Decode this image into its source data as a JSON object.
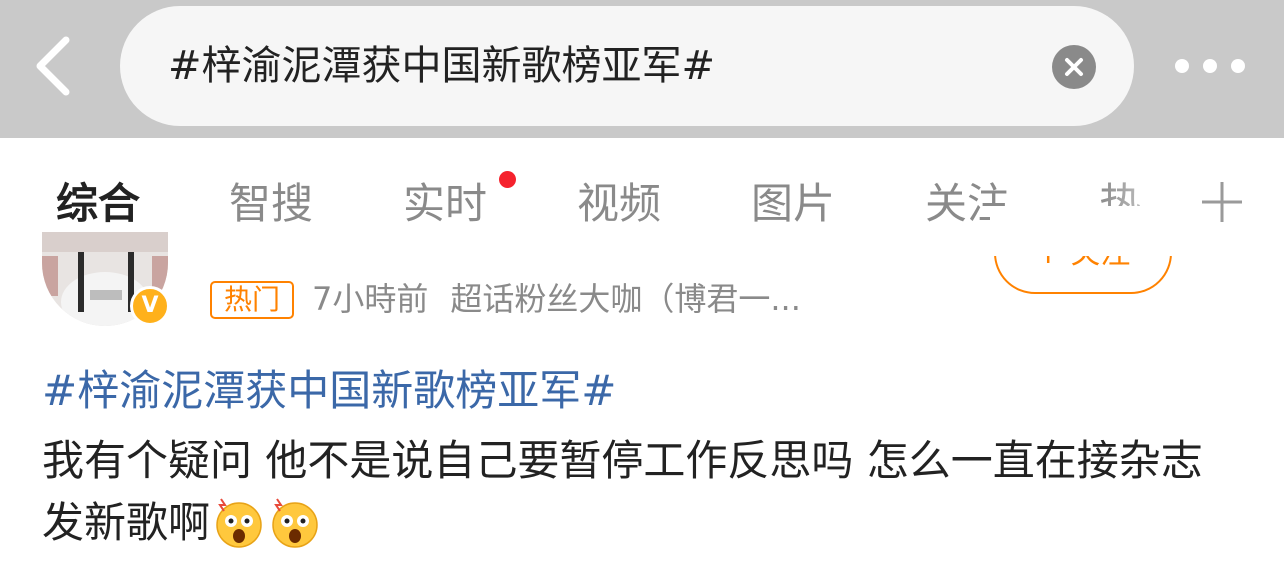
{
  "search": {
    "query": "#梓渝泥潭获中国新歌榜亚军#"
  },
  "icons": {
    "back": "chevron-left-icon",
    "clear": "close-circle-icon",
    "more": "more-dots-icon",
    "plus": "plus-icon"
  },
  "tabs": [
    {
      "label": "综合",
      "active": true
    },
    {
      "label": "智搜"
    },
    {
      "label": "实时",
      "badge": "red-dot"
    },
    {
      "label": "视频"
    },
    {
      "label": "图片"
    },
    {
      "label": "关注"
    },
    {
      "label": "热"
    }
  ],
  "post": {
    "hot_badge": "热门",
    "time": "7小時前",
    "source": "超话粉丝大咖（博君一...",
    "follow_label": "+ 关注",
    "hashtag": "#梓渝泥潭获中国新歌榜亚军#",
    "text": "我有个疑问 他不是说自己要暂停工作反思吗 怎么一直在接杂志发新歌啊",
    "emojis": [
      "shocked-emoji",
      "shocked-emoji"
    ]
  },
  "colors": {
    "accent": "#ff8200",
    "link": "#3b68a8",
    "topbar": "#c9c9c9",
    "dot": "#f5222d",
    "verified": "#ffb11b"
  }
}
